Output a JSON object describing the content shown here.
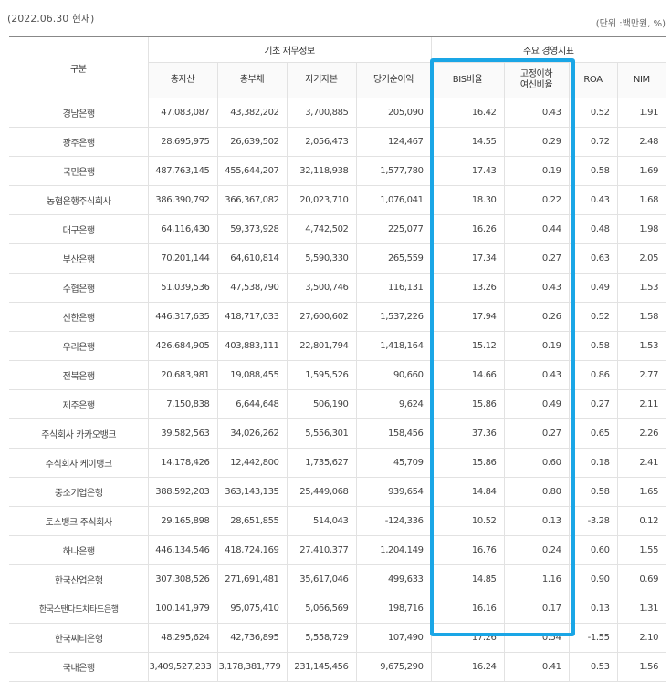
{
  "header": {
    "date": "(2022.06.30 현재)",
    "unit": "(단위 :백만원, %)"
  },
  "table": {
    "col_group": "구분",
    "group_basic": "기초 재무정보",
    "group_key": "주요 경영지표",
    "columns": [
      "총자산",
      "총부채",
      "자기자본",
      "당기순이익",
      "BIS비율",
      "고정이하",
      "여신비율",
      "ROA",
      "NIM"
    ],
    "rows": [
      [
        "경남은행",
        "47,083,087",
        "43,382,202",
        "3,700,885",
        "205,090",
        "16.42",
        "0.43",
        "0.52",
        "1.91"
      ],
      [
        "광주은행",
        "28,695,975",
        "26,639,502",
        "2,056,473",
        "124,467",
        "14.55",
        "0.29",
        "0.72",
        "2.48"
      ],
      [
        "국민은행",
        "487,763,145",
        "455,644,207",
        "32,118,938",
        "1,577,780",
        "17.43",
        "0.19",
        "0.58",
        "1.69"
      ],
      [
        "농협은행주식회사",
        "386,390,792",
        "366,367,082",
        "20,023,710",
        "1,076,041",
        "18.30",
        "0.22",
        "0.43",
        "1.68"
      ],
      [
        "대구은행",
        "64,116,430",
        "59,373,928",
        "4,742,502",
        "225,077",
        "16.26",
        "0.44",
        "0.48",
        "1.98"
      ],
      [
        "부산은행",
        "70,201,144",
        "64,610,814",
        "5,590,330",
        "265,559",
        "17.34",
        "0.27",
        "0.63",
        "2.05"
      ],
      [
        "수협은행",
        "51,039,536",
        "47,538,790",
        "3,500,746",
        "116,131",
        "13.26",
        "0.43",
        "0.49",
        "1.53"
      ],
      [
        "신한은행",
        "446,317,635",
        "418,717,033",
        "27,600,602",
        "1,537,226",
        "17.94",
        "0.26",
        "0.52",
        "1.58"
      ],
      [
        "우리은행",
        "426,684,905",
        "403,883,111",
        "22,801,794",
        "1,418,164",
        "15.12",
        "0.19",
        "0.58",
        "1.53"
      ],
      [
        "전북은행",
        "20,683,981",
        "19,088,455",
        "1,595,526",
        "90,660",
        "14.66",
        "0.43",
        "0.86",
        "2.77"
      ],
      [
        "제주은행",
        "7,150,838",
        "6,644,648",
        "506,190",
        "9,624",
        "15.86",
        "0.49",
        "0.27",
        "2.11"
      ],
      [
        "주식회사 카카오뱅크",
        "39,582,563",
        "34,026,262",
        "5,556,301",
        "158,456",
        "37.36",
        "0.27",
        "0.65",
        "2.26"
      ],
      [
        "주식회사 케이뱅크",
        "14,178,426",
        "12,442,800",
        "1,735,627",
        "45,709",
        "15.86",
        "0.60",
        "0.18",
        "2.41"
      ],
      [
        "중소기업은행",
        "388,592,203",
        "363,143,135",
        "25,449,068",
        "939,654",
        "14.84",
        "0.80",
        "0.58",
        "1.65"
      ],
      [
        "토스뱅크 주식회사",
        "29,165,898",
        "28,651,855",
        "514,043",
        "-124,336",
        "10.52",
        "0.13",
        "-3.28",
        "0.12"
      ],
      [
        "하나은행",
        "446,134,546",
        "418,724,169",
        "27,410,377",
        "1,204,149",
        "16.76",
        "0.24",
        "0.60",
        "1.55"
      ],
      [
        "한국산업은행",
        "307,308,526",
        "271,691,481",
        "35,617,046",
        "499,633",
        "14.85",
        "1.16",
        "0.90",
        "0.69"
      ],
      [
        "한국스탠다드차타드은행",
        "100,141,979",
        "95,075,410",
        "5,066,569",
        "198,716",
        "16.16",
        "0.17",
        "0.13",
        "1.31"
      ],
      [
        "한국씨티은행",
        "48,295,624",
        "42,736,895",
        "5,558,729",
        "107,490",
        "17.26",
        "0.54",
        "-1.55",
        "2.10"
      ],
      [
        "국내은행",
        "3,409,527,233",
        "3,178,381,779",
        "231,145,456",
        "9,675,290",
        "16.24",
        "0.41",
        "0.53",
        "1.56"
      ]
    ]
  },
  "colors": {
    "highlight_border": "#1aa6e6",
    "header_rule": "#888888"
  }
}
